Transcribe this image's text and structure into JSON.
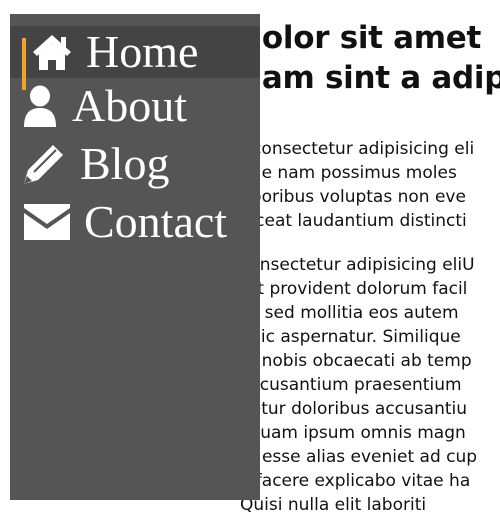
{
  "colors": {
    "sidebar_bg": "#555555",
    "active_bg": "#444444",
    "active_indicator": "#f4a12c",
    "nav_text": "#ffffff",
    "content_text": "#111111"
  },
  "sidebar": {
    "items": [
      {
        "label": "Home",
        "icon": "home-icon",
        "active": true
      },
      {
        "label": "About",
        "icon": "user-icon",
        "active": false
      },
      {
        "label": "Blog",
        "icon": "pencil-icon",
        "active": false
      },
      {
        "label": "Contact",
        "icon": "envelope-icon",
        "active": false
      }
    ]
  },
  "main": {
    "heading_lines": [
      "dolor sit amet",
      "dam sint a adip"
    ],
    "paragraphs": [
      [
        "t consectetur adipisicing eli",
        "que nam possimus moles",
        "nporibus voluptas non eve",
        "laceat laudantium distincti"
      ],
      [
        "consectetur adipisicing eliU",
        "rat provident dolorum facil",
        "sa sed mollitia eos autem",
        "l hic aspernatur. Similique",
        "d, nobis obcaecati ab temp",
        "accusantium praesentium",
        "netur doloribus accusantiu",
        "liquam ipsum omnis magn",
        "m esse alias eveniet ad cup",
        "o facere explicabo vitae ha",
        "Quisi nulla elit laboriti"
      ]
    ]
  }
}
